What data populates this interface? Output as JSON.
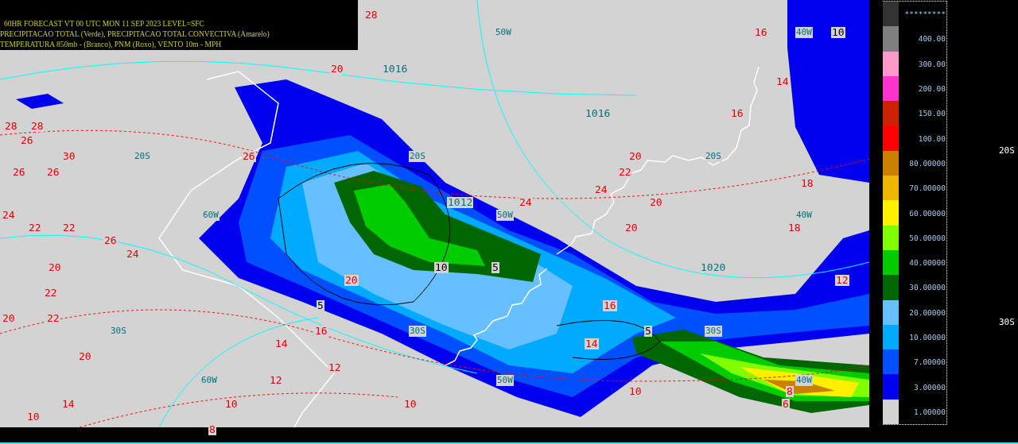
{
  "header": {
    "lines": [
      "60HR FORECAST    VT 00 UTC MON 11 SEP 2023    LEVEL=SFC",
      "PRECIPITACAO TOTAL (Verde), PRECIPITACAO TOTAL CONVECTIVA (Amarelo)",
      "TEMPERATURA 850mb - (Branco),  PNM (Roxo), VENTO 10m - MPH"
    ]
  },
  "map_labels": [
    {
      "text": "28",
      "kind": "temperature"
    },
    {
      "text": "50W",
      "kind": "grid"
    },
    {
      "text": "16",
      "kind": "temperature"
    },
    {
      "text": "40W",
      "kind": "grid"
    },
    {
      "text": "10",
      "kind": "precip"
    },
    {
      "text": "20",
      "kind": "temperature"
    },
    {
      "text": "1016",
      "kind": "pressure"
    },
    {
      "text": "14",
      "kind": "temperature"
    },
    {
      "text": "1016",
      "kind": "pressure"
    },
    {
      "text": "16",
      "kind": "temperature"
    },
    {
      "text": "28",
      "kind": "temperature"
    },
    {
      "text": "28",
      "kind": "temperature"
    },
    {
      "text": "26",
      "kind": "temperature"
    },
    {
      "text": "30",
      "kind": "temperature"
    },
    {
      "text": "20S",
      "kind": "grid"
    },
    {
      "text": "26",
      "kind": "temperature"
    },
    {
      "text": "20S",
      "kind": "grid"
    },
    {
      "text": "20",
      "kind": "temperature"
    },
    {
      "text": "20S",
      "kind": "grid"
    },
    {
      "text": "26",
      "kind": "temperature"
    },
    {
      "text": "26",
      "kind": "temperature"
    },
    {
      "text": "22",
      "kind": "temperature"
    },
    {
      "text": "18",
      "kind": "temperature"
    },
    {
      "text": "24",
      "kind": "temperature"
    },
    {
      "text": "1012",
      "kind": "pressure"
    },
    {
      "text": "24",
      "kind": "temperature"
    },
    {
      "text": "20",
      "kind": "temperature"
    },
    {
      "text": "24",
      "kind": "temperature"
    },
    {
      "text": "60W",
      "kind": "grid"
    },
    {
      "text": "50W",
      "kind": "grid"
    },
    {
      "text": "40W",
      "kind": "grid"
    },
    {
      "text": "22",
      "kind": "temperature"
    },
    {
      "text": "22",
      "kind": "temperature"
    },
    {
      "text": "20",
      "kind": "temperature"
    },
    {
      "text": "18",
      "kind": "temperature"
    },
    {
      "text": "26",
      "kind": "temperature"
    },
    {
      "text": "24",
      "kind": "temperature"
    },
    {
      "text": "20",
      "kind": "temperature"
    },
    {
      "text": "10",
      "kind": "precip"
    },
    {
      "text": "5",
      "kind": "precip"
    },
    {
      "text": "1020",
      "kind": "pressure"
    },
    {
      "text": "20",
      "kind": "temperature"
    },
    {
      "text": "12",
      "kind": "temperature"
    },
    {
      "text": "22",
      "kind": "temperature"
    },
    {
      "text": "5",
      "kind": "precip"
    },
    {
      "text": "16",
      "kind": "temperature"
    },
    {
      "text": "20",
      "kind": "temperature"
    },
    {
      "text": "22",
      "kind": "temperature"
    },
    {
      "text": "30S",
      "kind": "grid"
    },
    {
      "text": "16",
      "kind": "temperature"
    },
    {
      "text": "30S",
      "kind": "grid"
    },
    {
      "text": "5",
      "kind": "precip"
    },
    {
      "text": "30S",
      "kind": "grid"
    },
    {
      "text": "14",
      "kind": "temperature"
    },
    {
      "text": "14",
      "kind": "temperature"
    },
    {
      "text": "20",
      "kind": "temperature"
    },
    {
      "text": "12",
      "kind": "temperature"
    },
    {
      "text": "60W",
      "kind": "grid"
    },
    {
      "text": "12",
      "kind": "temperature"
    },
    {
      "text": "50W",
      "kind": "grid"
    },
    {
      "text": "40W",
      "kind": "grid"
    },
    {
      "text": "8",
      "kind": "temperature"
    },
    {
      "text": "10",
      "kind": "temperature"
    },
    {
      "text": "14",
      "kind": "temperature"
    },
    {
      "text": "10",
      "kind": "temperature"
    },
    {
      "text": "10",
      "kind": "temperature"
    },
    {
      "text": "6",
      "kind": "temperature"
    },
    {
      "text": "10",
      "kind": "temperature"
    },
    {
      "text": "8",
      "kind": "temperature"
    }
  ],
  "legend": [
    {
      "label": "*********",
      "color": "#333333"
    },
    {
      "label": "400.00",
      "color": "#7f7f7f"
    },
    {
      "label": "300.00",
      "color": "#ff99cc"
    },
    {
      "label": "200.00",
      "color": "#ff33cc"
    },
    {
      "label": "150.00",
      "color": "#cc2200"
    },
    {
      "label": "100.00",
      "color": "#ff0000"
    },
    {
      "label": "80.00000",
      "color": "#cc8000"
    },
    {
      "label": "70.00000",
      "color": "#eeb400"
    },
    {
      "label": "60.00000",
      "color": "#fff000"
    },
    {
      "label": "50.00000",
      "color": "#80ff00"
    },
    {
      "label": "40.00000",
      "color": "#00cc00"
    },
    {
      "label": "30.00000",
      "color": "#006600"
    },
    {
      "label": "20.00000",
      "color": "#66c0ff"
    },
    {
      "label": "10.00000",
      "color": "#00aaff"
    },
    {
      "label": "7.00000",
      "color": "#0050ff"
    },
    {
      "label": "3.00000",
      "color": "#0000ee"
    },
    {
      "label": "1.00000",
      "color": "#d3d3d3"
    }
  ],
  "side_labels": [
    "20S",
    "30S"
  ]
}
